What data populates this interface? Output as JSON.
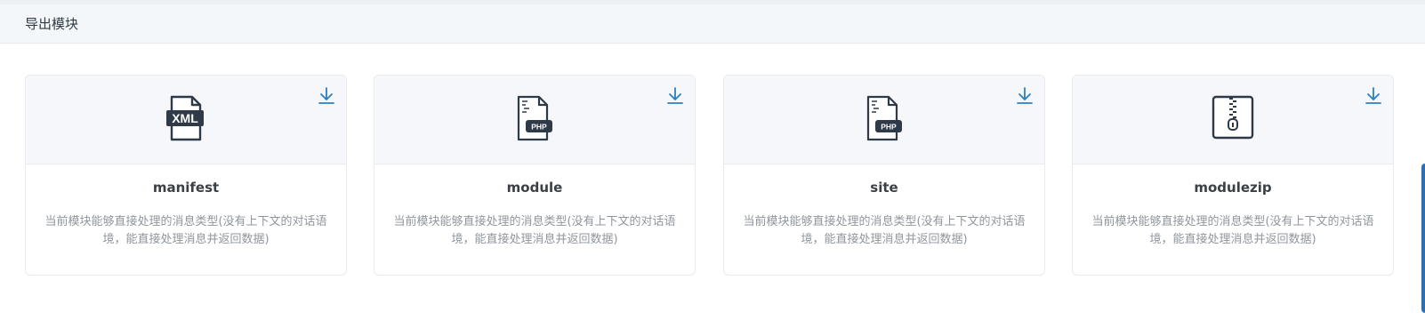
{
  "header": {
    "title": "导出模块"
  },
  "cards": [
    {
      "name": "manifest",
      "icon": "xml-file-icon",
      "icon_text": "XML",
      "description": "当前模块能够直接处理的消息类型(没有上下文的对话语境，能直接处理消息并返回数据)"
    },
    {
      "name": "module",
      "icon": "php-file-icon",
      "icon_text": "PHP",
      "description": "当前模块能够直接处理的消息类型(没有上下文的对话语境，能直接处理消息并返回数据)"
    },
    {
      "name": "site",
      "icon": "php-file-icon",
      "icon_text": "PHP",
      "description": "当前模块能够直接处理的消息类型(没有上下文的对话语境，能直接处理消息并返回数据)"
    },
    {
      "name": "modulezip",
      "icon": "zip-file-icon",
      "icon_text": "",
      "description": "当前模块能够直接处理的消息类型(没有上下文的对话语境，能直接处理消息并返回数据)"
    }
  ],
  "colors": {
    "accent": "#2f6fb0",
    "download": "#2b7fc4",
    "icon_dark": "#2f3a48"
  }
}
